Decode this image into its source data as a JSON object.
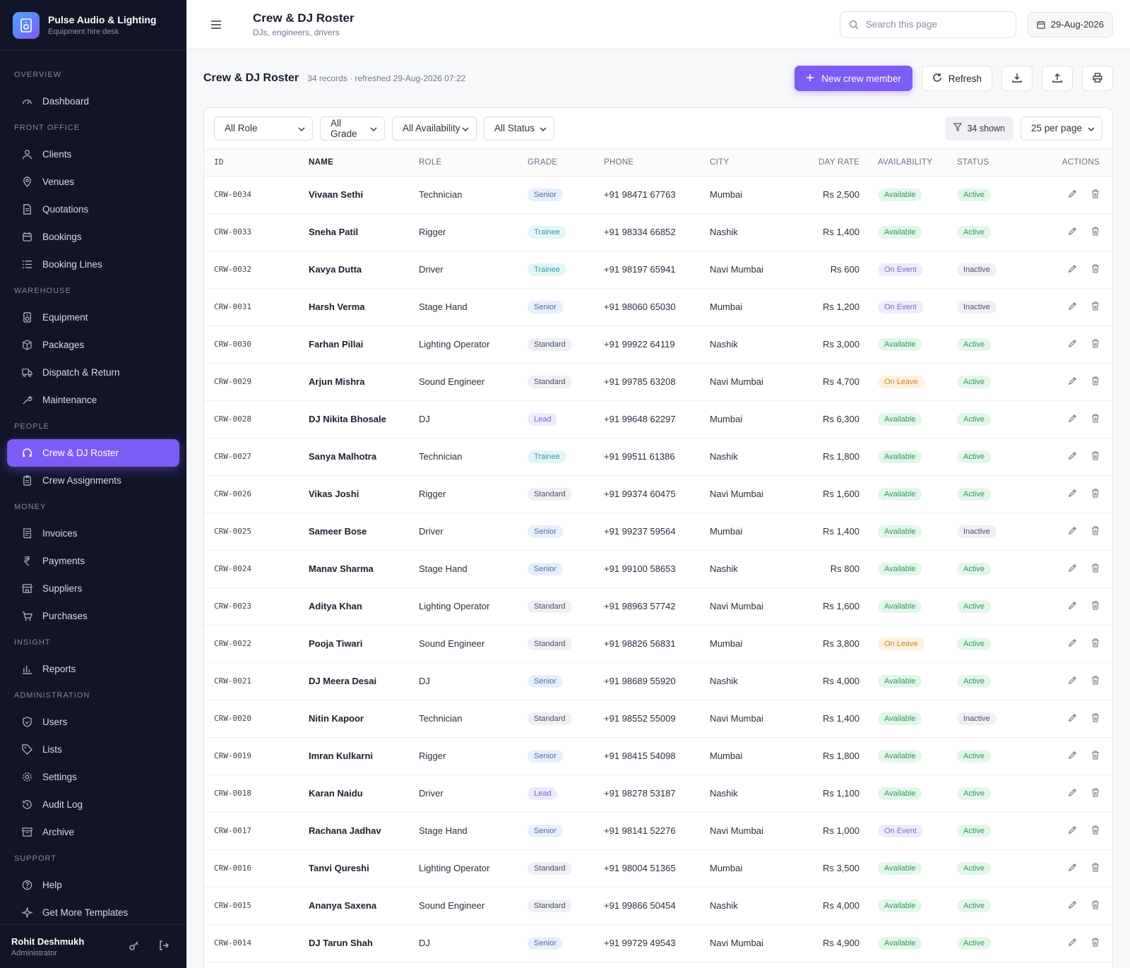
{
  "brand": {
    "name": "Pulse Audio & Lighting",
    "tagline": "Equipment hire desk"
  },
  "sidebar": {
    "sections": [
      {
        "title": "OVERVIEW",
        "items": [
          {
            "label": "Dashboard",
            "icon": "gauge-icon"
          }
        ]
      },
      {
        "title": "FRONT OFFICE",
        "items": [
          {
            "label": "Clients",
            "icon": "users-icon"
          },
          {
            "label": "Venues",
            "icon": "map-pin-icon"
          },
          {
            "label": "Quotations",
            "icon": "document-icon"
          },
          {
            "label": "Bookings",
            "icon": "calendar-icon"
          },
          {
            "label": "Booking Lines",
            "icon": "list-icon"
          }
        ]
      },
      {
        "title": "WAREHOUSE",
        "items": [
          {
            "label": "Equipment",
            "icon": "speaker-icon"
          },
          {
            "label": "Packages",
            "icon": "box-icon"
          },
          {
            "label": "Dispatch & Return",
            "icon": "truck-icon"
          },
          {
            "label": "Maintenance",
            "icon": "wrench-icon"
          }
        ]
      },
      {
        "title": "PEOPLE",
        "items": [
          {
            "label": "Crew & DJ Roster",
            "icon": "headphones-icon",
            "active": true
          },
          {
            "label": "Crew Assignments",
            "icon": "clipboard-icon"
          }
        ]
      },
      {
        "title": "MONEY",
        "items": [
          {
            "label": "Invoices",
            "icon": "invoice-icon"
          },
          {
            "label": "Payments",
            "icon": "rupee-icon"
          },
          {
            "label": "Suppliers",
            "icon": "store-icon"
          },
          {
            "label": "Purchases",
            "icon": "cart-icon"
          }
        ]
      },
      {
        "title": "INSIGHT",
        "items": [
          {
            "label": "Reports",
            "icon": "bar-chart-icon"
          }
        ]
      },
      {
        "title": "ADMINISTRATION",
        "items": [
          {
            "label": "Users",
            "icon": "shield-icon"
          },
          {
            "label": "Lists",
            "icon": "tag-icon"
          },
          {
            "label": "Settings",
            "icon": "gear-icon"
          },
          {
            "label": "Audit Log",
            "icon": "history-icon"
          },
          {
            "label": "Archive",
            "icon": "archive-icon"
          }
        ]
      },
      {
        "title": "SUPPORT",
        "items": [
          {
            "label": "Help",
            "icon": "help-icon"
          },
          {
            "label": "Get More Templates",
            "icon": "sparkle-icon"
          }
        ]
      }
    ],
    "user": {
      "name": "Rohit Deshmukh",
      "role": "Administrator"
    }
  },
  "topbar": {
    "title": "Crew & DJ Roster",
    "subtitle": "DJs, engineers, drivers",
    "search_placeholder": "Search this page",
    "date": "29-Aug-2026"
  },
  "content": {
    "title": "Crew & DJ Roster",
    "meta": "34 records · refreshed 29-Aug-2026 07:22",
    "new_button": "New crew member",
    "refresh_button": "Refresh"
  },
  "filters": {
    "role": "All Role",
    "grade": "All Grade",
    "availability": "All Availability",
    "status": "All Status",
    "shown": "34 shown",
    "per_page": "25 per page"
  },
  "table": {
    "columns": [
      "ID",
      "NAME",
      "ROLE",
      "GRADE",
      "PHONE",
      "CITY",
      "DAY RATE",
      "AVAILABILITY",
      "STATUS",
      "ACTIONS"
    ],
    "rows": [
      {
        "id": "CRW-0034",
        "name": "Vivaan Sethi",
        "role": "Technician",
        "grade": "Senior",
        "phone": "+91 98471 67763",
        "city": "Mumbai",
        "rate": "Rs 2,500",
        "availability": "Available",
        "status": "Active"
      },
      {
        "id": "CRW-0033",
        "name": "Sneha Patil",
        "role": "Rigger",
        "grade": "Trainee",
        "phone": "+91 98334 66852",
        "city": "Nashik",
        "rate": "Rs 1,400",
        "availability": "Available",
        "status": "Active"
      },
      {
        "id": "CRW-0032",
        "name": "Kavya Dutta",
        "role": "Driver",
        "grade": "Trainee",
        "phone": "+91 98197 65941",
        "city": "Navi Mumbai",
        "rate": "Rs 600",
        "availability": "On Event",
        "status": "Inactive"
      },
      {
        "id": "CRW-0031",
        "name": "Harsh Verma",
        "role": "Stage Hand",
        "grade": "Senior",
        "phone": "+91 98060 65030",
        "city": "Mumbai",
        "rate": "Rs 1,200",
        "availability": "On Event",
        "status": "Inactive"
      },
      {
        "id": "CRW-0030",
        "name": "Farhan Pillai",
        "role": "Lighting Operator",
        "grade": "Standard",
        "phone": "+91 99922 64119",
        "city": "Nashik",
        "rate": "Rs 3,000",
        "availability": "Available",
        "status": "Active"
      },
      {
        "id": "CRW-0029",
        "name": "Arjun Mishra",
        "role": "Sound Engineer",
        "grade": "Standard",
        "phone": "+91 99785 63208",
        "city": "Navi Mumbai",
        "rate": "Rs 4,700",
        "availability": "On Leave",
        "status": "Active"
      },
      {
        "id": "CRW-0028",
        "name": "DJ Nikita Bhosale",
        "role": "DJ",
        "grade": "Lead",
        "phone": "+91 99648 62297",
        "city": "Mumbai",
        "rate": "Rs 6,300",
        "availability": "Available",
        "status": "Active"
      },
      {
        "id": "CRW-0027",
        "name": "Sanya Malhotra",
        "role": "Technician",
        "grade": "Trainee",
        "phone": "+91 99511 61386",
        "city": "Nashik",
        "rate": "Rs 1,800",
        "availability": "Available",
        "status": "Active"
      },
      {
        "id": "CRW-0026",
        "name": "Vikas Joshi",
        "role": "Rigger",
        "grade": "Standard",
        "phone": "+91 99374 60475",
        "city": "Navi Mumbai",
        "rate": "Rs 1,600",
        "availability": "Available",
        "status": "Active"
      },
      {
        "id": "CRW-0025",
        "name": "Sameer Bose",
        "role": "Driver",
        "grade": "Senior",
        "phone": "+91 99237 59564",
        "city": "Mumbai",
        "rate": "Rs 1,400",
        "availability": "Available",
        "status": "Inactive"
      },
      {
        "id": "CRW-0024",
        "name": "Manav Sharma",
        "role": "Stage Hand",
        "grade": "Senior",
        "phone": "+91 99100 58653",
        "city": "Nashik",
        "rate": "Rs 800",
        "availability": "Available",
        "status": "Active"
      },
      {
        "id": "CRW-0023",
        "name": "Aditya Khan",
        "role": "Lighting Operator",
        "grade": "Standard",
        "phone": "+91 98963 57742",
        "city": "Navi Mumbai",
        "rate": "Rs 1,600",
        "availability": "Available",
        "status": "Active"
      },
      {
        "id": "CRW-0022",
        "name": "Pooja Tiwari",
        "role": "Sound Engineer",
        "grade": "Standard",
        "phone": "+91 98826 56831",
        "city": "Mumbai",
        "rate": "Rs 3,800",
        "availability": "On Leave",
        "status": "Active"
      },
      {
        "id": "CRW-0021",
        "name": "DJ Meera Desai",
        "role": "DJ",
        "grade": "Senior",
        "phone": "+91 98689 55920",
        "city": "Nashik",
        "rate": "Rs 4,000",
        "availability": "Available",
        "status": "Active"
      },
      {
        "id": "CRW-0020",
        "name": "Nitin Kapoor",
        "role": "Technician",
        "grade": "Standard",
        "phone": "+91 98552 55009",
        "city": "Navi Mumbai",
        "rate": "Rs 1,400",
        "availability": "Available",
        "status": "Inactive"
      },
      {
        "id": "CRW-0019",
        "name": "Imran Kulkarni",
        "role": "Rigger",
        "grade": "Senior",
        "phone": "+91 98415 54098",
        "city": "Mumbai",
        "rate": "Rs 1,800",
        "availability": "Available",
        "status": "Active"
      },
      {
        "id": "CRW-0018",
        "name": "Karan Naidu",
        "role": "Driver",
        "grade": "Lead",
        "phone": "+91 98278 53187",
        "city": "Nashik",
        "rate": "Rs 1,100",
        "availability": "Available",
        "status": "Active"
      },
      {
        "id": "CRW-0017",
        "name": "Rachana Jadhav",
        "role": "Stage Hand",
        "grade": "Senior",
        "phone": "+91 98141 52276",
        "city": "Navi Mumbai",
        "rate": "Rs 1,000",
        "availability": "On Event",
        "status": "Active"
      },
      {
        "id": "CRW-0016",
        "name": "Tanvi Qureshi",
        "role": "Lighting Operator",
        "grade": "Standard",
        "phone": "+91 98004 51365",
        "city": "Mumbai",
        "rate": "Rs 3,500",
        "availability": "Available",
        "status": "Active"
      },
      {
        "id": "CRW-0015",
        "name": "Ananya Saxena",
        "role": "Sound Engineer",
        "grade": "Standard",
        "phone": "+91 99866 50454",
        "city": "Nashik",
        "rate": "Rs 4,000",
        "availability": "Available",
        "status": "Active"
      },
      {
        "id": "CRW-0014",
        "name": "DJ Tarun Shah",
        "role": "DJ",
        "grade": "Senior",
        "phone": "+91 99729 49543",
        "city": "Navi Mumbai",
        "rate": "Rs 4,900",
        "availability": "Available",
        "status": "Active"
      }
    ]
  },
  "colors": {
    "accent": "#7c5cf6",
    "sidebar_bg": "#121528"
  }
}
